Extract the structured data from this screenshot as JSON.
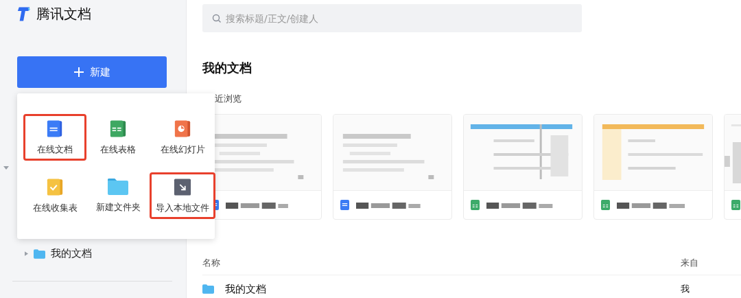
{
  "app": {
    "name": "腾讯文档"
  },
  "new_button": {
    "label": "新建"
  },
  "new_menu": {
    "items": [
      {
        "label": "在线文档",
        "kind": "doc",
        "marked": true
      },
      {
        "label": "在线表格",
        "kind": "sheet",
        "marked": false
      },
      {
        "label": "在线幻灯片",
        "kind": "slide",
        "marked": false
      },
      {
        "label": "在线收集表",
        "kind": "form",
        "marked": false
      },
      {
        "label": "新建文件夹",
        "kind": "folder",
        "marked": false
      },
      {
        "label": "导入本地文件",
        "kind": "import",
        "marked": true
      }
    ]
  },
  "sidebar": {
    "tree": [
      {
        "label": "我的文档",
        "expanded": false
      }
    ]
  },
  "search": {
    "placeholder": "搜索标题/正文/创建人"
  },
  "page_title": "我的文档",
  "recent": {
    "heading": "近浏览",
    "cards": [
      {
        "kind": "doc"
      },
      {
        "kind": "doc"
      },
      {
        "kind": "sheet"
      },
      {
        "kind": "sheet"
      },
      {
        "kind": "sheet"
      }
    ]
  },
  "table": {
    "columns": [
      "名称",
      "来自"
    ],
    "rows": [
      {
        "name": "我的文档",
        "from": "我"
      }
    ]
  }
}
